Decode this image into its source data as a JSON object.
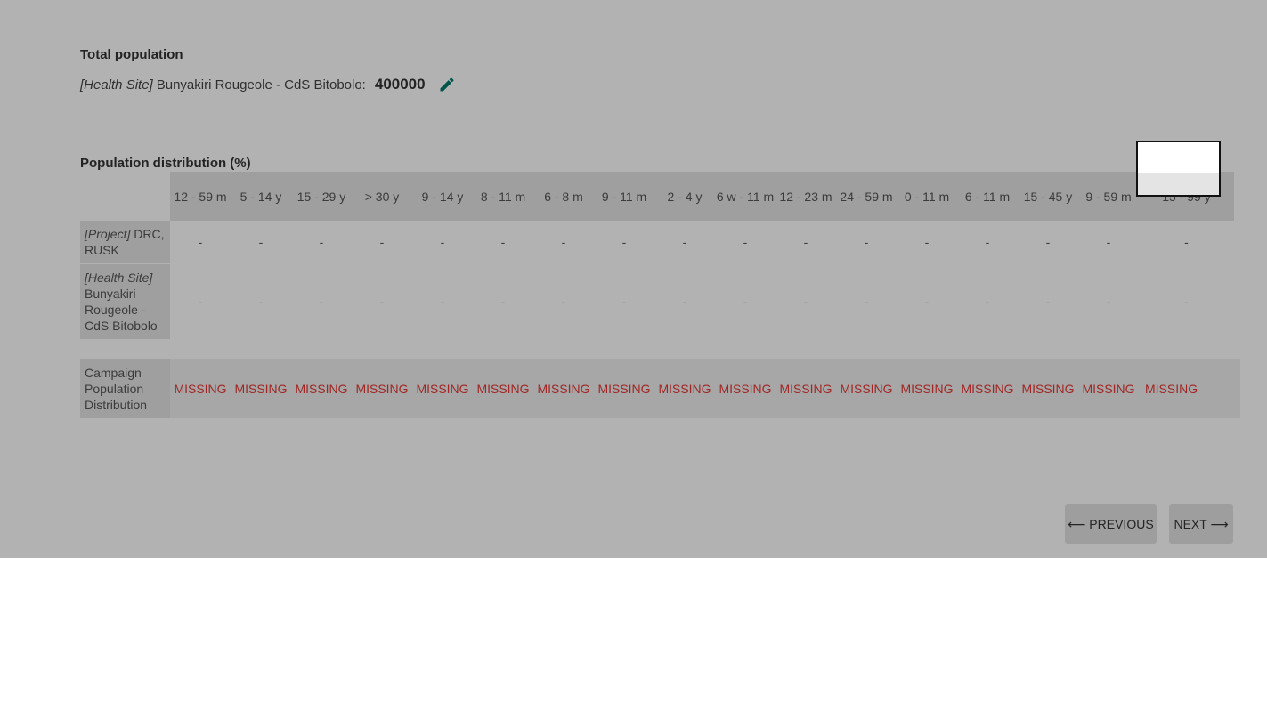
{
  "total_population": {
    "title": "Total population",
    "kind": "[Health Site]",
    "name": "Bunyakiri Rougeole - CdS Bitobolo:",
    "value": "400000",
    "edit_icon": "pencil-icon"
  },
  "distribution": {
    "title": "Population distribution (%)",
    "columns": [
      "12 - 59 m",
      "5 - 14 y",
      "15 - 29 y",
      "> 30 y",
      "9 - 14 y",
      "8 - 11 m",
      "6 - 8 m",
      "9 - 11 m",
      "2 - 4 y",
      "6 w - 11 m",
      "12 - 23 m",
      "24 - 59 m",
      "0 - 11 m",
      "6 - 11 m",
      "15 - 45 y",
      "9 - 59 m",
      "15 - 99 y"
    ],
    "rows": [
      {
        "kind": "[Project]",
        "name": "DRC, RUSK",
        "values": [
          "-",
          "-",
          "-",
          "-",
          "-",
          "-",
          "-",
          "-",
          "-",
          "-",
          "-",
          "-",
          "-",
          "-",
          "-",
          "-",
          "-"
        ]
      },
      {
        "kind": "[Health Site]",
        "name": "Bunyakiri Rougeole - CdS Bitobolo",
        "values": [
          "-",
          "-",
          "-",
          "-",
          "-",
          "-",
          "-",
          "-",
          "-",
          "-",
          "-",
          "-",
          "-",
          "-",
          "-",
          "-",
          "-"
        ]
      }
    ]
  },
  "campaign": {
    "label": "Campaign Population Distribution",
    "values": [
      "MISSING",
      "MISSING",
      "MISSING",
      "MISSING",
      "MISSING",
      "MISSING",
      "MISSING",
      "MISSING",
      "MISSING",
      "MISSING",
      "MISSING",
      "MISSING",
      "MISSING",
      "MISSING",
      "MISSING",
      "MISSING",
      "MISSING"
    ]
  },
  "nav": {
    "previous": "⟵ PREVIOUS",
    "next": "NEXT ⟶"
  },
  "colors": {
    "missing": "#e53935",
    "edit_icon": "#00796b",
    "header_bg": "#e4e4e4"
  }
}
